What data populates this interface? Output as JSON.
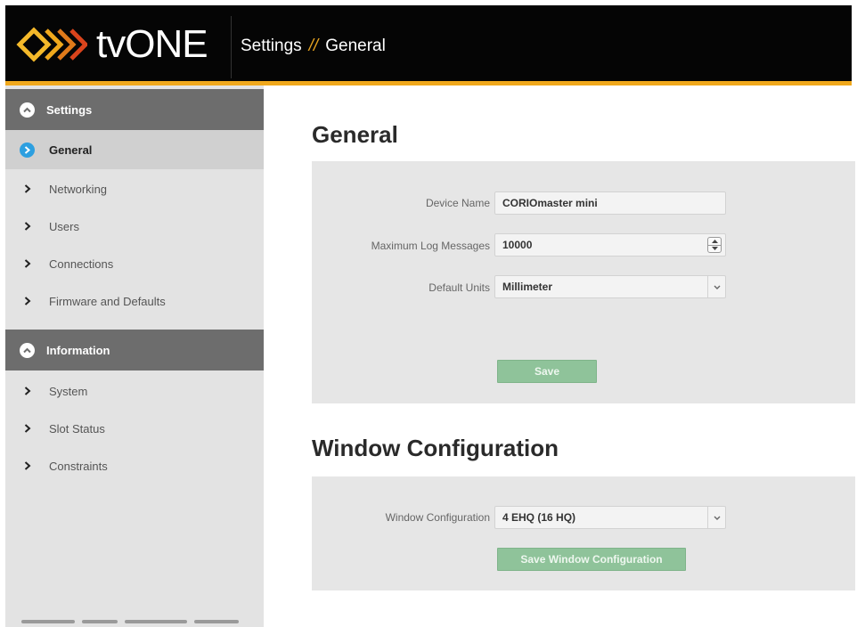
{
  "header": {
    "brand": "tvONE",
    "breadcrumb_root": "Settings",
    "breadcrumb_sep": "//",
    "breadcrumb_page": "General",
    "accent_color": "#f0a81c",
    "logo_icon": "chevron-logo-icon"
  },
  "sidebar": {
    "sections": [
      {
        "label": "Settings",
        "icon": "chevron-up-circle-icon"
      },
      {
        "label": "Information",
        "icon": "chevron-up-circle-icon"
      }
    ],
    "settings_items": [
      {
        "label": "General",
        "active": true
      },
      {
        "label": "Networking"
      },
      {
        "label": "Users"
      },
      {
        "label": "Connections"
      },
      {
        "label": "Firmware and Defaults"
      }
    ],
    "information_items": [
      {
        "label": "System"
      },
      {
        "label": "Slot Status"
      },
      {
        "label": "Constraints"
      }
    ]
  },
  "general": {
    "title": "General",
    "device_name_label": "Device Name",
    "device_name_value": "CORIOmaster mini",
    "max_log_label": "Maximum Log Messages",
    "max_log_value": "10000",
    "default_units_label": "Default Units",
    "default_units_value": "Millimeter",
    "save_label": "Save"
  },
  "window_config": {
    "title": "Window Configuration",
    "label": "Window Configuration",
    "value": "4 EHQ (16 HQ)",
    "save_label": "Save Window Configuration"
  },
  "colors": {
    "active_nav": "#2d9fe0",
    "button": "#8fc39a",
    "section_header": "#6d6d6d"
  }
}
